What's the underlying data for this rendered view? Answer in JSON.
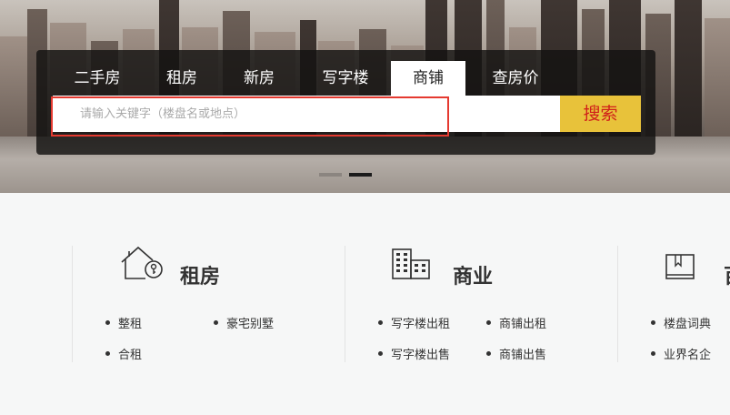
{
  "search_tabs": [
    "二手房",
    "租房",
    "新房",
    "写字楼",
    "商铺",
    "查房价"
  ],
  "active_tab": "商铺",
  "search": {
    "placeholder": "请输入关键字（楼盘名或地点）",
    "value": "",
    "button_label": "搜索"
  },
  "carousel": {
    "slides": 2,
    "active": 2
  },
  "categories": [
    {
      "title": "租房",
      "icon": "house-key-icon",
      "items": [
        "整租",
        "豪宅别墅",
        "合租"
      ]
    },
    {
      "title": "商业",
      "icon": "buildings-icon",
      "items": [
        "写字楼出租",
        "商铺出租",
        "写字楼出售",
        "商铺出售"
      ]
    },
    {
      "title": "百科",
      "icon": "book-icon",
      "items": [
        "楼盘词典",
        "业界名企"
      ]
    }
  ],
  "colors": {
    "search_button_bg": "#e8c23a",
    "search_button_text": "#d0201a",
    "highlight_outline": "#e53a30"
  }
}
